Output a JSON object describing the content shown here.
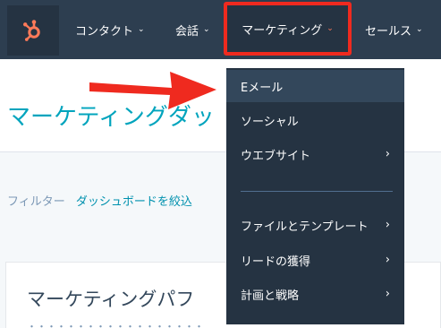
{
  "nav": {
    "items": [
      {
        "label": "コンタクト"
      },
      {
        "label": "会話"
      },
      {
        "label": "マーケティング"
      },
      {
        "label": "セールス"
      }
    ],
    "chevron": "⌄"
  },
  "page": {
    "title": "マーケティングダッ",
    "filter_label": "フィルター",
    "filter_link": "ダッシュボードを絞込",
    "card_title": "マーケティングパフ",
    "card_sub": "・・・・・・・・・・・・・・・・・・"
  },
  "dropdown": {
    "items": [
      {
        "label": "Eメール"
      },
      {
        "label": "ソーシャル"
      },
      {
        "label": "ウエブサイト"
      },
      {
        "label": "ファイルとテンプレート"
      },
      {
        "label": "リードの獲得"
      },
      {
        "label": "計画と戦略"
      }
    ],
    "chevron": "›"
  },
  "colors": {
    "nav_bg": "#2d3e50",
    "dropdown_bg": "#253342",
    "highlight_red": "#ef2a1f",
    "title_teal": "#00a4bd",
    "accent_orange": "#ff7a59"
  },
  "icons": {
    "logo": "hubspot-sprocket-icon",
    "annotation": "red-arrow-icon"
  }
}
